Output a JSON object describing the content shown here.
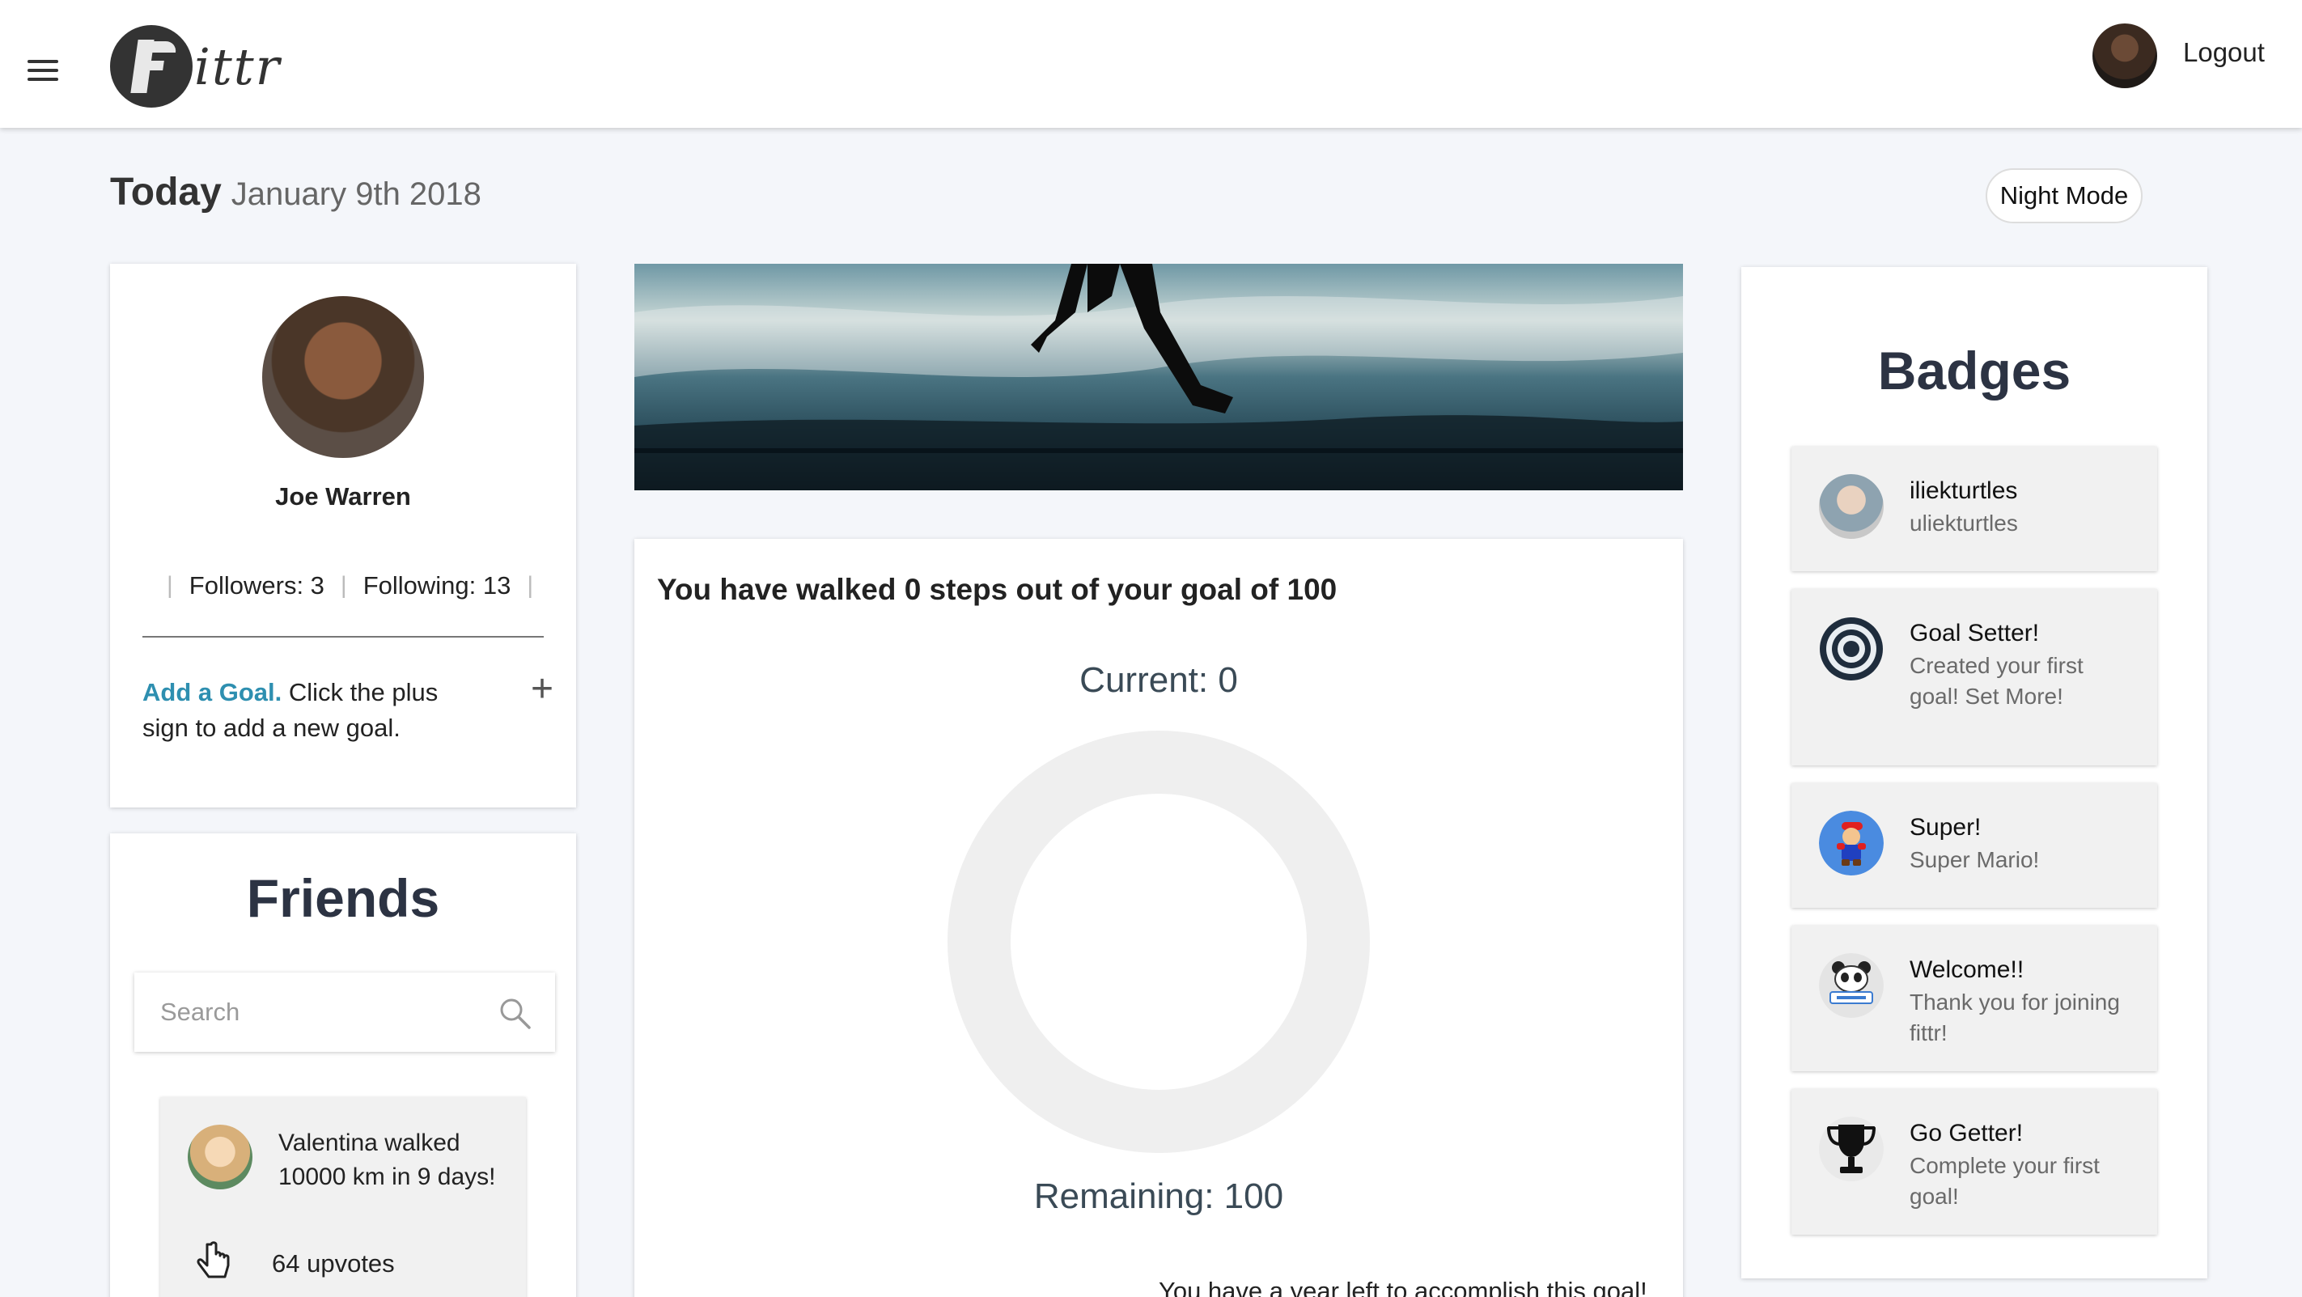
{
  "header": {
    "logo_text": "ittr",
    "logout_label": "Logout"
  },
  "date_row": {
    "today_label": "Today",
    "date": "January 9th 2018",
    "night_mode_label": "Night Mode"
  },
  "profile": {
    "name": "Joe Warren",
    "followers_label": "Followers: 3",
    "following_label": "Following: 13",
    "separator": "|",
    "add_goal_link": "Add a Goal.",
    "add_goal_text": " Click the plus sign to add a new goal.",
    "plus_symbol": "+"
  },
  "friends": {
    "title": "Friends",
    "search_placeholder": "Search",
    "items": [
      {
        "text": "Valentina walked 10000 km in 9 days!",
        "upvotes_label": "64 upvotes"
      }
    ]
  },
  "steps": {
    "title": "You have walked 0 steps out of your goal of 100",
    "current_label": "Current: 0",
    "remaining_label": "Remaining: 100",
    "current_value": 0,
    "goal_value": 100,
    "ring_color": "#efefef",
    "progress_color": "#2e8fb0",
    "year_left_text": "You have a year left to accomplish this goal!"
  },
  "badges": {
    "title": "Badges",
    "items": [
      {
        "title": "iliekturtles",
        "desc": "uliekturtles",
        "icon": "user-photo-icon"
      },
      {
        "title": "Goal Setter!",
        "desc": "Created your first goal! Set More!",
        "icon": "target-icon"
      },
      {
        "title": "Super!",
        "desc": "Super Mario!",
        "icon": "mario-icon"
      },
      {
        "title": "Welcome!!",
        "desc": "Thank you for joining fittr!",
        "icon": "panda-welcome-icon"
      },
      {
        "title": "Go Getter!",
        "desc": "Complete your first goal!",
        "icon": "trophy-icon"
      }
    ]
  },
  "colors": {
    "accent": "#2e8fb0",
    "background": "#f4f6fa",
    "heading": "#2c3343"
  }
}
